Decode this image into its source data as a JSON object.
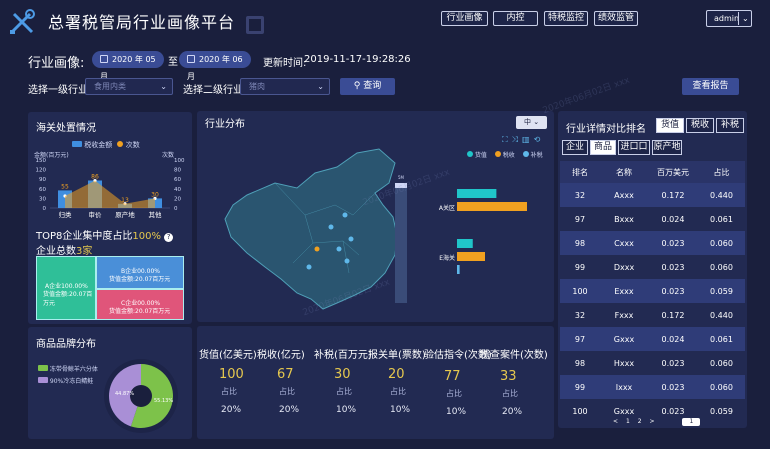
{
  "header": {
    "title": "总署税管局行业画像平台",
    "nav": [
      "行业画像",
      "内控",
      "特税监控",
      "绩效监管"
    ],
    "user": "admin"
  },
  "filters": {
    "industry_profile_label": "行业画像:",
    "date_from": "2020 年 05 月",
    "date_to": "2020 年 06 月",
    "range_sep": "至",
    "updated_label": "更新时间:",
    "updated_value": "2019-11-17-19:28:26",
    "level1_label": "选择一级行业:",
    "level1_value": "食用内类",
    "level2_label": "选择二级行业:",
    "level2_value": "猪肉",
    "query_button": "查询",
    "report_button": "查看报告"
  },
  "customs": {
    "title": "海关处置情况",
    "legend_bar": "税收金额",
    "legend_line": "次数",
    "left_axis_title": "金额(百万元)",
    "right_axis_title": "次数",
    "left_ticks": [
      "150",
      "120",
      "90",
      "60",
      "30",
      "0"
    ],
    "right_ticks": [
      "100",
      "80",
      "60",
      "40",
      "20",
      "0"
    ],
    "categories": [
      "归类",
      "审价",
      "原产地",
      "其他"
    ],
    "bar_labels": [
      "55",
      "86",
      "13",
      "30"
    ],
    "top8_label": "TOP8企业集中度占比",
    "top8_value": "100%",
    "enterprise_label": "企业总数",
    "enterprise_value": "3家",
    "tiles": [
      {
        "name": "A企业100.00%",
        "value": "货值金额:20.07百万元",
        "color": "#2fbf98"
      },
      {
        "name": "B企业00.00%",
        "value": "货值金额:20.07百万元",
        "color": "#4a8fd8"
      },
      {
        "name": "C企业00.00%",
        "value": "货值金额:20.07百万元",
        "color": "#e0557a"
      }
    ]
  },
  "chart_data": [
    {
      "type": "bar",
      "title": "海关处置情况",
      "categories": [
        "归类",
        "审价",
        "原产地",
        "其他"
      ],
      "series": [
        {
          "name": "税收金额",
          "type": "bar",
          "values": [
            55,
            86,
            13,
            30
          ],
          "axis": "left"
        },
        {
          "name": "次数",
          "type": "line",
          "values": [
            25,
            57,
            9,
            20
          ],
          "axis": "right"
        }
      ],
      "ylabel": "金额(百万元)",
      "y2label": "次数",
      "ylim": [
        0,
        150
      ],
      "y2lim": [
        0,
        100
      ]
    },
    {
      "type": "bar",
      "title": "行业分布",
      "categories": [
        "A关区",
        "E海关"
      ],
      "series": [
        {
          "name": "货值",
          "values": [
            45,
            18
          ]
        },
        {
          "name": "税收",
          "values": [
            80,
            32
          ]
        },
        {
          "name": "补税",
          "values": [
            0,
            3
          ]
        }
      ]
    },
    {
      "type": "pie",
      "title": "商品品牌分布",
      "labels": [
        "冻带骨鲸羊六分体",
        "90%冷冻白鲭鲑"
      ],
      "values": [
        55.13,
        44.87
      ]
    }
  ],
  "distribution": {
    "title": "行业分布",
    "select": "中",
    "legend": [
      "货值",
      "税收",
      "补税"
    ],
    "legend_colors": [
      "#20c5c9",
      "#f0a020",
      "#5fb8ea"
    ],
    "rows": [
      "A关区",
      "E海关"
    ],
    "scale_label": "5M"
  },
  "brand": {
    "title": "商品品牌分布",
    "legend": [
      "冻带骨鲸羊六分体",
      "90%冷冻白鲭鲑"
    ],
    "colors": [
      "#7dc24a",
      "#a98fd6"
    ],
    "pct_left": "44.87%",
    "pct_right": "55.13%"
  },
  "stats": [
    {
      "label": "货值(亿美元)",
      "value": "100",
      "sub": "占比",
      "pct": "20%"
    },
    {
      "label": "税收(亿元)",
      "value": "67",
      "sub": "占比",
      "pct": "20%"
    },
    {
      "label": "补税(百万元)",
      "value": "30",
      "sub": "占比",
      "pct": "10%"
    },
    {
      "label": "报关单(票数)",
      "value": "20",
      "sub": "占比",
      "pct": "10%"
    },
    {
      "label": "验估指令(次数)",
      "value": "77",
      "sub": "占比",
      "pct": "10%"
    },
    {
      "label": "稽查案件(次数)",
      "value": "33",
      "sub": "占比",
      "pct": "20%"
    }
  ],
  "ranking": {
    "title": "行业详情对比排名",
    "tabs_metric": [
      "货值",
      "税收",
      "补税"
    ],
    "tabs_kind": [
      "企业",
      "商品",
      "进口口",
      "原产地"
    ],
    "columns": [
      "排名",
      "名称",
      "百万美元",
      "占比"
    ],
    "rows": [
      [
        "32",
        "Axxx",
        "0.172",
        "0.440"
      ],
      [
        "97",
        "Bxxx",
        "0.024",
        "0.061"
      ],
      [
        "98",
        "Cxxx",
        "0.023",
        "0.060"
      ],
      [
        "99",
        "Dxxx",
        "0.023",
        "0.060"
      ],
      [
        "100",
        "Exxx",
        "0.023",
        "0.059"
      ],
      [
        "32",
        "Fxxx",
        "0.172",
        "0.440"
      ],
      [
        "97",
        "Gxxx",
        "0.024",
        "0.061"
      ],
      [
        "98",
        "Hxxx",
        "0.023",
        "0.060"
      ],
      [
        "99",
        "Ixxx",
        "0.023",
        "0.060"
      ],
      [
        "100",
        "Gxxx",
        "0.023",
        "0.059"
      ]
    ],
    "pager": [
      "<",
      "1",
      "2",
      ">",
      "1"
    ]
  },
  "watermark": "2020年06月02日 xxx"
}
